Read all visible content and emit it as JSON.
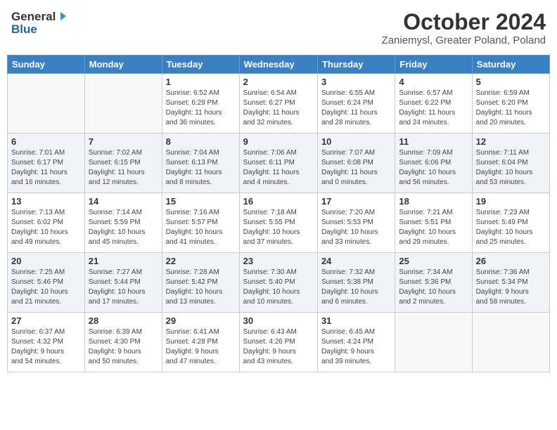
{
  "header": {
    "logo": {
      "general": "General",
      "blue": "Blue",
      "arrow_title": "GeneralBlue logo"
    },
    "title": "October 2024",
    "location": "Zaniemysl, Greater Poland, Poland"
  },
  "weekdays": [
    "Sunday",
    "Monday",
    "Tuesday",
    "Wednesday",
    "Thursday",
    "Friday",
    "Saturday"
  ],
  "weeks": [
    [
      {
        "day": "",
        "info": ""
      },
      {
        "day": "",
        "info": ""
      },
      {
        "day": "1",
        "info": "Sunrise: 6:52 AM\nSunset: 6:29 PM\nDaylight: 11 hours\nand 36 minutes."
      },
      {
        "day": "2",
        "info": "Sunrise: 6:54 AM\nSunset: 6:27 PM\nDaylight: 11 hours\nand 32 minutes."
      },
      {
        "day": "3",
        "info": "Sunrise: 6:55 AM\nSunset: 6:24 PM\nDaylight: 11 hours\nand 28 minutes."
      },
      {
        "day": "4",
        "info": "Sunrise: 6:57 AM\nSunset: 6:22 PM\nDaylight: 11 hours\nand 24 minutes."
      },
      {
        "day": "5",
        "info": "Sunrise: 6:59 AM\nSunset: 6:20 PM\nDaylight: 11 hours\nand 20 minutes."
      }
    ],
    [
      {
        "day": "6",
        "info": "Sunrise: 7:01 AM\nSunset: 6:17 PM\nDaylight: 11 hours\nand 16 minutes."
      },
      {
        "day": "7",
        "info": "Sunrise: 7:02 AM\nSunset: 6:15 PM\nDaylight: 11 hours\nand 12 minutes."
      },
      {
        "day": "8",
        "info": "Sunrise: 7:04 AM\nSunset: 6:13 PM\nDaylight: 11 hours\nand 8 minutes."
      },
      {
        "day": "9",
        "info": "Sunrise: 7:06 AM\nSunset: 6:11 PM\nDaylight: 11 hours\nand 4 minutes."
      },
      {
        "day": "10",
        "info": "Sunrise: 7:07 AM\nSunset: 6:08 PM\nDaylight: 11 hours\nand 0 minutes."
      },
      {
        "day": "11",
        "info": "Sunrise: 7:09 AM\nSunset: 6:06 PM\nDaylight: 10 hours\nand 56 minutes."
      },
      {
        "day": "12",
        "info": "Sunrise: 7:11 AM\nSunset: 6:04 PM\nDaylight: 10 hours\nand 53 minutes."
      }
    ],
    [
      {
        "day": "13",
        "info": "Sunrise: 7:13 AM\nSunset: 6:02 PM\nDaylight: 10 hours\nand 49 minutes."
      },
      {
        "day": "14",
        "info": "Sunrise: 7:14 AM\nSunset: 5:59 PM\nDaylight: 10 hours\nand 45 minutes."
      },
      {
        "day": "15",
        "info": "Sunrise: 7:16 AM\nSunset: 5:57 PM\nDaylight: 10 hours\nand 41 minutes."
      },
      {
        "day": "16",
        "info": "Sunrise: 7:18 AM\nSunset: 5:55 PM\nDaylight: 10 hours\nand 37 minutes."
      },
      {
        "day": "17",
        "info": "Sunrise: 7:20 AM\nSunset: 5:53 PM\nDaylight: 10 hours\nand 33 minutes."
      },
      {
        "day": "18",
        "info": "Sunrise: 7:21 AM\nSunset: 5:51 PM\nDaylight: 10 hours\nand 29 minutes."
      },
      {
        "day": "19",
        "info": "Sunrise: 7:23 AM\nSunset: 5:49 PM\nDaylight: 10 hours\nand 25 minutes."
      }
    ],
    [
      {
        "day": "20",
        "info": "Sunrise: 7:25 AM\nSunset: 5:46 PM\nDaylight: 10 hours\nand 21 minutes."
      },
      {
        "day": "21",
        "info": "Sunrise: 7:27 AM\nSunset: 5:44 PM\nDaylight: 10 hours\nand 17 minutes."
      },
      {
        "day": "22",
        "info": "Sunrise: 7:28 AM\nSunset: 5:42 PM\nDaylight: 10 hours\nand 13 minutes."
      },
      {
        "day": "23",
        "info": "Sunrise: 7:30 AM\nSunset: 5:40 PM\nDaylight: 10 hours\nand 10 minutes."
      },
      {
        "day": "24",
        "info": "Sunrise: 7:32 AM\nSunset: 5:38 PM\nDaylight: 10 hours\nand 6 minutes."
      },
      {
        "day": "25",
        "info": "Sunrise: 7:34 AM\nSunset: 5:36 PM\nDaylight: 10 hours\nand 2 minutes."
      },
      {
        "day": "26",
        "info": "Sunrise: 7:36 AM\nSunset: 5:34 PM\nDaylight: 9 hours\nand 58 minutes."
      }
    ],
    [
      {
        "day": "27",
        "info": "Sunrise: 6:37 AM\nSunset: 4:32 PM\nDaylight: 9 hours\nand 54 minutes."
      },
      {
        "day": "28",
        "info": "Sunrise: 6:39 AM\nSunset: 4:30 PM\nDaylight: 9 hours\nand 50 minutes."
      },
      {
        "day": "29",
        "info": "Sunrise: 6:41 AM\nSunset: 4:28 PM\nDaylight: 9 hours\nand 47 minutes."
      },
      {
        "day": "30",
        "info": "Sunrise: 6:43 AM\nSunset: 4:26 PM\nDaylight: 9 hours\nand 43 minutes."
      },
      {
        "day": "31",
        "info": "Sunrise: 6:45 AM\nSunset: 4:24 PM\nDaylight: 9 hours\nand 39 minutes."
      },
      {
        "day": "",
        "info": ""
      },
      {
        "day": "",
        "info": ""
      }
    ]
  ]
}
